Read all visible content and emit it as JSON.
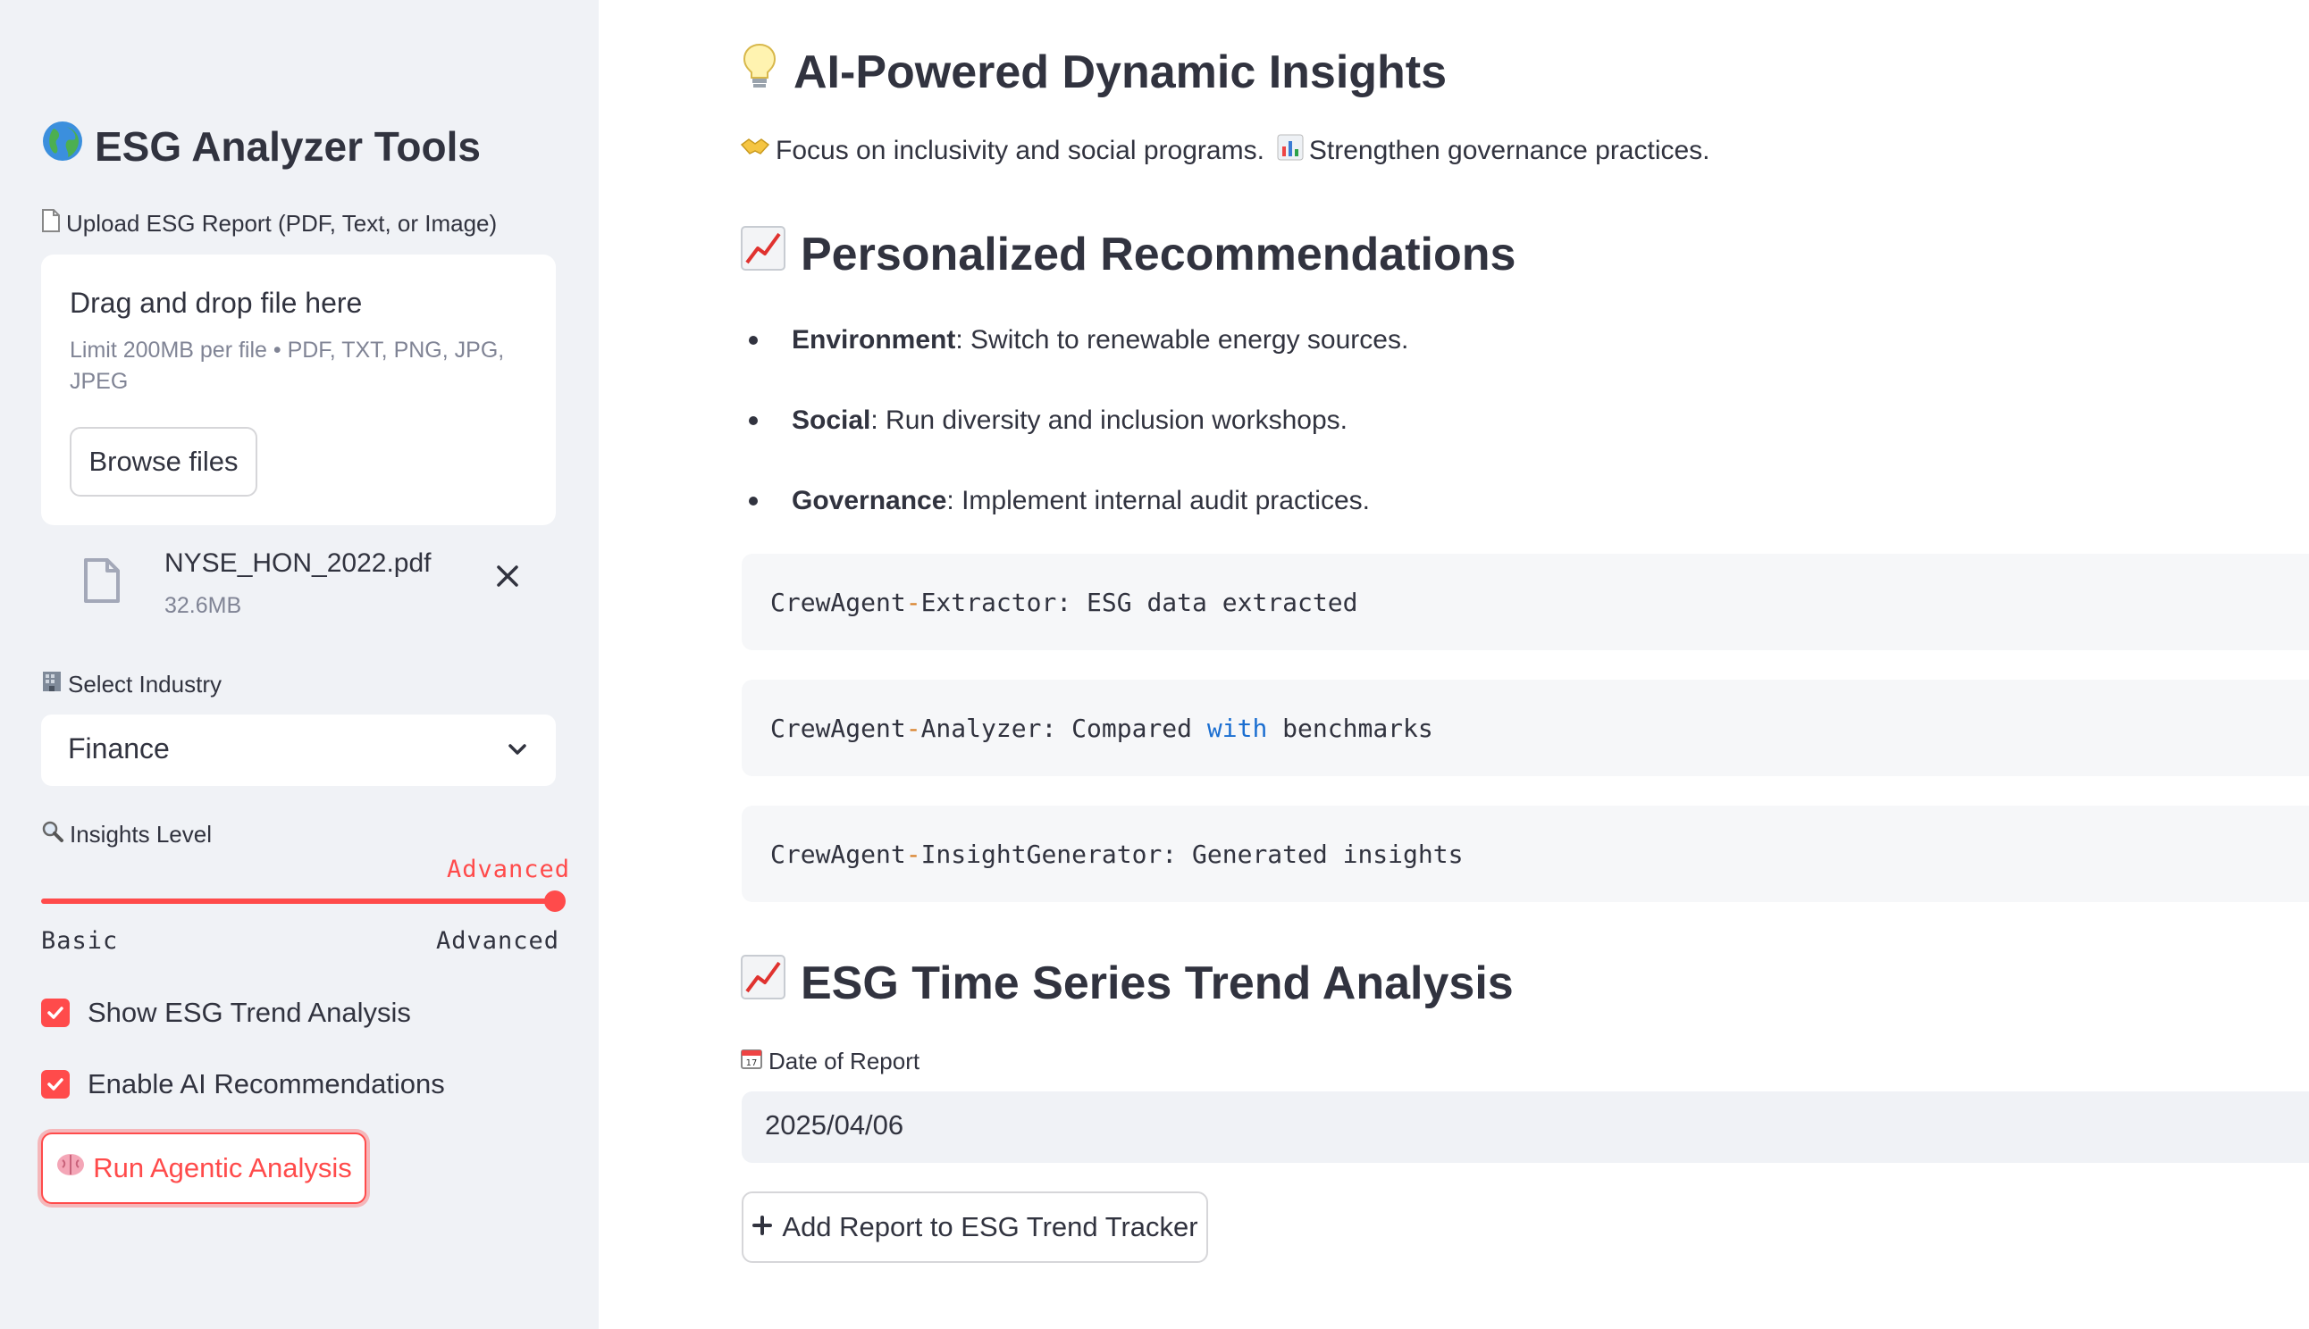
{
  "sidebar": {
    "title": "ESG Analyzer Tools",
    "title_icon": "globe-icon",
    "upload_label": "Upload ESG Report (PDF, Text, or Image)",
    "uploader": {
      "drag_text": "Drag and drop file here",
      "limit_text": "Limit 200MB per file • PDF, TXT, PNG, JPG, JPEG",
      "browse_label": "Browse files"
    },
    "file": {
      "name": "NYSE_HON_2022.pdf",
      "size": "32.6MB"
    },
    "industry_label": "Select Industry",
    "industry_value": "Finance",
    "insights_label": "Insights Level",
    "slider": {
      "value": "Advanced",
      "min": "Basic",
      "max": "Advanced",
      "fraction": 1.0
    },
    "checkboxes": [
      {
        "label": "Show ESG Trend Analysis",
        "checked": true
      },
      {
        "label": "Enable AI Recommendations",
        "checked": true
      }
    ],
    "run_label": "Run Agentic Analysis"
  },
  "main": {
    "insights_title": "AI-Powered Dynamic Insights",
    "insights_text_1": "Focus on inclusivity and social programs.",
    "insights_text_2": "Strengthen governance practices.",
    "recs_title": "Personalized Recommendations",
    "recommendations": [
      {
        "key": "Environment",
        "text": ": Switch to renewable energy sources."
      },
      {
        "key": "Social",
        "text": ": Run diversity and inclusion workshops."
      },
      {
        "key": "Governance",
        "text": ": Implement internal audit practices."
      }
    ],
    "code_lines": [
      {
        "a": "CrewAgent",
        "op": "-",
        "b": "Extractor",
        "colon": ":",
        "rest": " ESG data extracted"
      },
      {
        "a": "CrewAgent",
        "op": "-",
        "b": "Analyzer",
        "colon": ":",
        "rest1": " Compared ",
        "kw": "with",
        "rest2": " benchmarks"
      },
      {
        "a": "CrewAgent",
        "op": "-",
        "b": "InsightGenerator",
        "colon": ":",
        "rest": " Generated insights"
      }
    ],
    "trend_title": "ESG Time Series Trend Analysis",
    "date_label": "Date of Report",
    "date_value": "2025/04/06",
    "add_button": "Add Report to ESG Trend Tracker"
  },
  "colors": {
    "accent": "#ff4b4b",
    "sidebar_bg": "#f0f2f6",
    "text": "#31333f"
  }
}
